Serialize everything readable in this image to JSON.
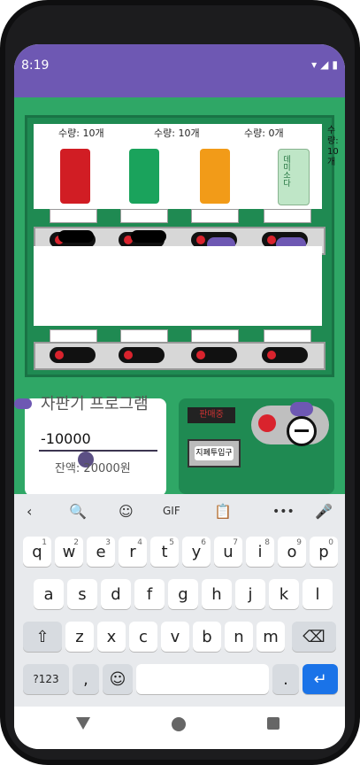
{
  "status": {
    "time": "8:19"
  },
  "vending": {
    "title": "자판기 프로그램",
    "input_value": "-10000",
    "balance": "잔액: 20000원",
    "sale": "판매중",
    "insert_button": "지폐투입구",
    "items": [
      {
        "qty": "수량: 10개",
        "color": "#d11d24"
      },
      {
        "qty": "수량: 10개",
        "color": "#1aa35c"
      },
      {
        "qty": "수량: 0개",
        "color": "#f29b18"
      },
      {
        "qty": "",
        "color": "#bfe6c7"
      }
    ],
    "side_text": "수\n량:\n10\n개",
    "drink4_label": "데미소다"
  },
  "keyboard": {
    "toolbar": [
      "‹",
      "🔍",
      "☺",
      "GIF",
      "📋",
      "•••",
      "🎤"
    ],
    "row1": [
      {
        "k": "q",
        "s": "1"
      },
      {
        "k": "w",
        "s": "2"
      },
      {
        "k": "e",
        "s": "3"
      },
      {
        "k": "r",
        "s": "4"
      },
      {
        "k": "t",
        "s": "5"
      },
      {
        "k": "y",
        "s": "6"
      },
      {
        "k": "u",
        "s": "7"
      },
      {
        "k": "i",
        "s": "8"
      },
      {
        "k": "o",
        "s": "9"
      },
      {
        "k": "p",
        "s": "0"
      }
    ],
    "row2": [
      "a",
      "s",
      "d",
      "f",
      "g",
      "h",
      "j",
      "k",
      "l"
    ],
    "row3": [
      "z",
      "x",
      "c",
      "v",
      "b",
      "n",
      "m"
    ],
    "bottom": {
      "mode": "?123",
      "comma": ",",
      "emoji": "☺",
      "period": ".",
      "enter": "↵"
    }
  }
}
